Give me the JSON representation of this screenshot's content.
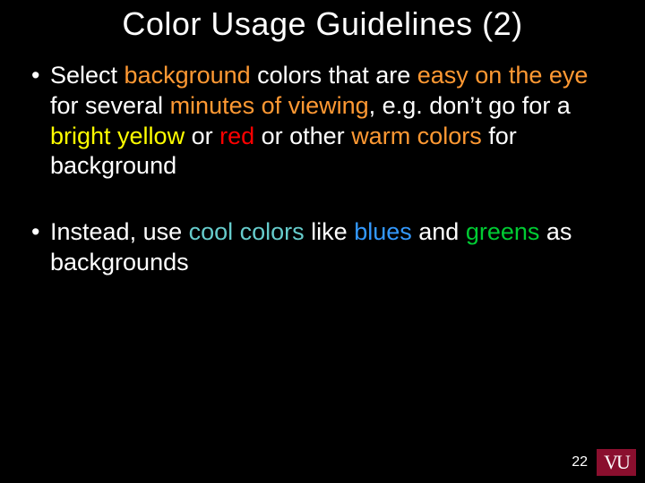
{
  "title": "Color Usage Guidelines (2)",
  "bullets": [
    {
      "runs": [
        {
          "t": "Select "
        },
        {
          "t": "background",
          "cls": "c-orange"
        },
        {
          "t": " colors that are "
        },
        {
          "t": "easy on the eye",
          "cls": "c-orange"
        },
        {
          "t": " for several "
        },
        {
          "t": "minutes of viewing",
          "cls": "c-orange"
        },
        {
          "t": ", e.g. don’t go for a "
        },
        {
          "t": "bright yellow",
          "cls": "c-yellow"
        },
        {
          "t": " or "
        },
        {
          "t": "red",
          "cls": "c-red"
        },
        {
          "t": " or other "
        },
        {
          "t": "warm colors",
          "cls": "c-orange"
        },
        {
          "t": " for background"
        }
      ]
    },
    {
      "runs": [
        {
          "t": "Instead, use "
        },
        {
          "t": "cool colors",
          "cls": "c-cool"
        },
        {
          "t": " like "
        },
        {
          "t": "blues",
          "cls": "c-blue"
        },
        {
          "t": " and "
        },
        {
          "t": "greens",
          "cls": "c-green"
        },
        {
          "t": " as backgrounds"
        }
      ]
    }
  ],
  "page_number": "22",
  "logo_text": "VU"
}
